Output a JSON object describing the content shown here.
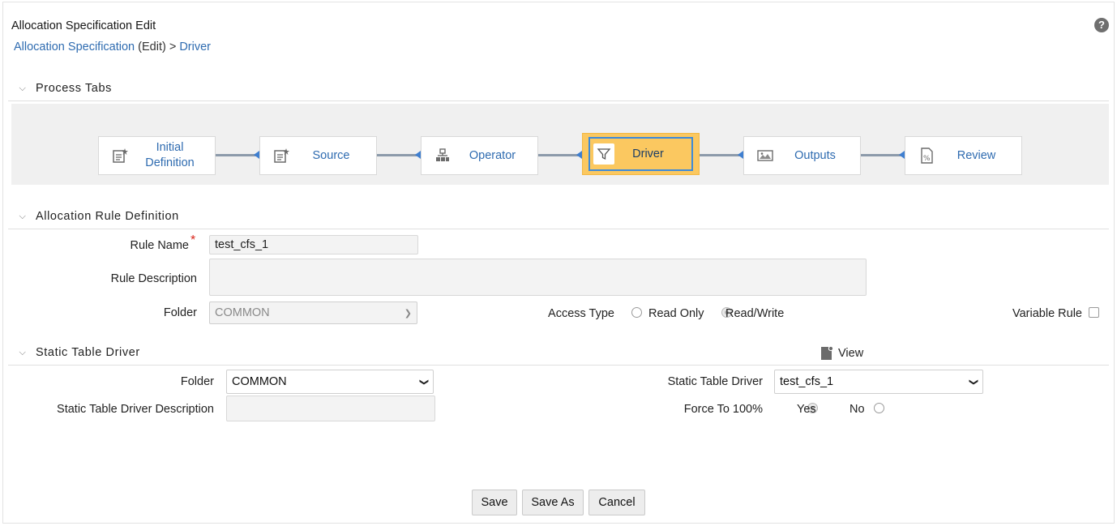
{
  "page": {
    "title": "Allocation Specification Edit",
    "help_label": "?"
  },
  "breadcrumb": {
    "link": "Allocation Specification",
    "mode": " (Edit) > ",
    "current": "Driver"
  },
  "sections": {
    "process_tabs": "Process Tabs",
    "rule_definition": "Allocation Rule Definition",
    "static_table_driver": "Static Table Driver"
  },
  "process_tabs": [
    {
      "label": "Initial\nDefinition",
      "icon": "document-edit-icon",
      "active": false
    },
    {
      "label": "Source",
      "icon": "document-edit-icon",
      "active": false
    },
    {
      "label": "Operator",
      "icon": "hierarchy-icon",
      "active": false
    },
    {
      "label": "Driver",
      "icon": "filter-icon",
      "active": true
    },
    {
      "label": "Outputs",
      "icon": "image-icon",
      "active": false
    },
    {
      "label": "Review",
      "icon": "percent-document-icon",
      "active": false
    }
  ],
  "rule_definition": {
    "rule_name_label": "Rule Name",
    "required_marker": "*",
    "rule_name_value": "test_cfs_1",
    "rule_description_label": "Rule Description",
    "rule_description_value": "",
    "folder_label": "Folder",
    "folder_value": "COMMON",
    "access_type_label": "Access Type",
    "access_options": [
      {
        "label": "Read Only",
        "checked": false
      },
      {
        "label": "Read/Write",
        "checked": true
      }
    ],
    "variable_rule_label": "Variable Rule",
    "variable_rule_checked": false
  },
  "static_driver": {
    "view_label": "View",
    "folder_label": "Folder",
    "folder_value": "COMMON",
    "description_label": "Static Table Driver Description",
    "description_value": "",
    "driver_label": "Static Table Driver",
    "driver_value": "test_cfs_1",
    "force_label": "Force To 100%",
    "force_options": [
      {
        "label": "Yes",
        "checked": true
      },
      {
        "label": "No",
        "checked": false
      }
    ]
  },
  "actions": {
    "save": "Save",
    "save_as": "Save As",
    "cancel": "Cancel"
  },
  "colors": {
    "link": "#2e6bb0",
    "active_tab": "#fbc860",
    "active_tab_border": "#3d8ad9",
    "required": "#d9261c"
  }
}
